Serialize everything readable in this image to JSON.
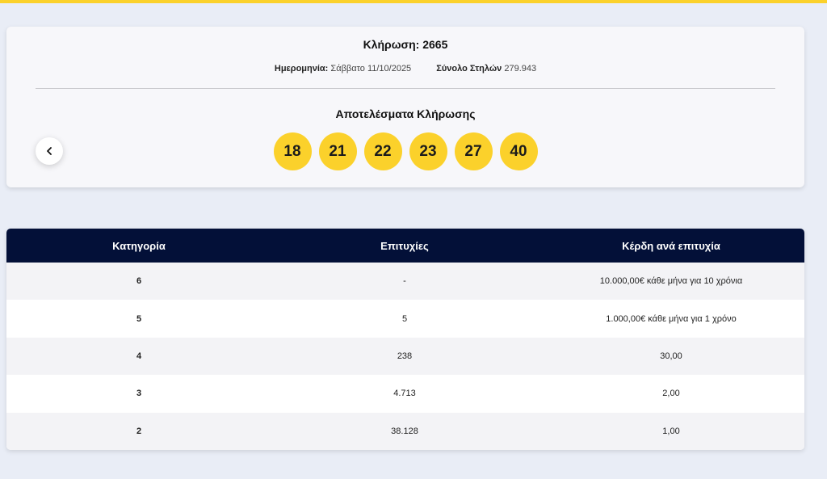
{
  "draw": {
    "title": "Κλήρωση: 2665",
    "date_label": "Ημερομηνία:",
    "date_value": "Σάββατο 11/10/2025",
    "columns_label": "Σύνολο Στηλών",
    "columns_value": "279.943",
    "results_title": "Αποτελέσματα Κλήρωσης",
    "numbers": [
      "18",
      "21",
      "22",
      "23",
      "27",
      "40"
    ],
    "prev_icon": "chevron-left-icon"
  },
  "table": {
    "headers": {
      "category": "Κατηγορία",
      "winners": "Επιτυχίες",
      "prize": "Κέρδη ανά επιτυχία"
    },
    "rows": [
      {
        "category": "6",
        "winners": "-",
        "prize": "10.000,00€ κάθε μήνα για 10 χρόνια"
      },
      {
        "category": "5",
        "winners": "5",
        "prize": "1.000,00€ κάθε μήνα για 1 χρόνο"
      },
      {
        "category": "4",
        "winners": "238",
        "prize": "30,00"
      },
      {
        "category": "3",
        "winners": "4.713",
        "prize": "2,00"
      },
      {
        "category": "2",
        "winners": "38.128",
        "prize": "1,00"
      }
    ]
  },
  "colors": {
    "accent_yellow": "#fbd12b",
    "header_navy": "#031038",
    "page_background": "#e9edf6"
  }
}
